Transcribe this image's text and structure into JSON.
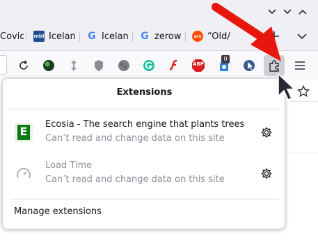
{
  "tabs": [
    {
      "label": "Covid",
      "favicon": "partial-icon"
    },
    {
      "label": "Icelan",
      "favicon": "mbl-favicon",
      "badge_text": "mbl"
    },
    {
      "label": "Icelan",
      "favicon": "google-favicon",
      "badge_text": "G"
    },
    {
      "label": "zerow",
      "favicon": "google-favicon",
      "badge_text": "G"
    },
    {
      "label": "“Old/",
      "favicon": "ars-favicon",
      "badge_text": "ars"
    }
  ],
  "toolbar": {
    "notification_count": "0",
    "abp_label": "ABP"
  },
  "panel": {
    "title": "Extensions",
    "extensions": [
      {
        "name": "Ecosia - The search engine that plants trees",
        "description": "Can’t read and change data on this site",
        "icon": "ecosia-icon",
        "enabled": true,
        "icon_letter": "E"
      },
      {
        "name": "Load Time",
        "description": "Can’t read and change data on this site",
        "icon": "gauge-icon",
        "enabled": false
      }
    ],
    "manage_label": "Manage extensions"
  },
  "colors": {
    "ecosia_green": "#008009",
    "arrow_red": "#e8160c",
    "abp_red": "#d81e1e",
    "google_blue": "#4285f4"
  }
}
